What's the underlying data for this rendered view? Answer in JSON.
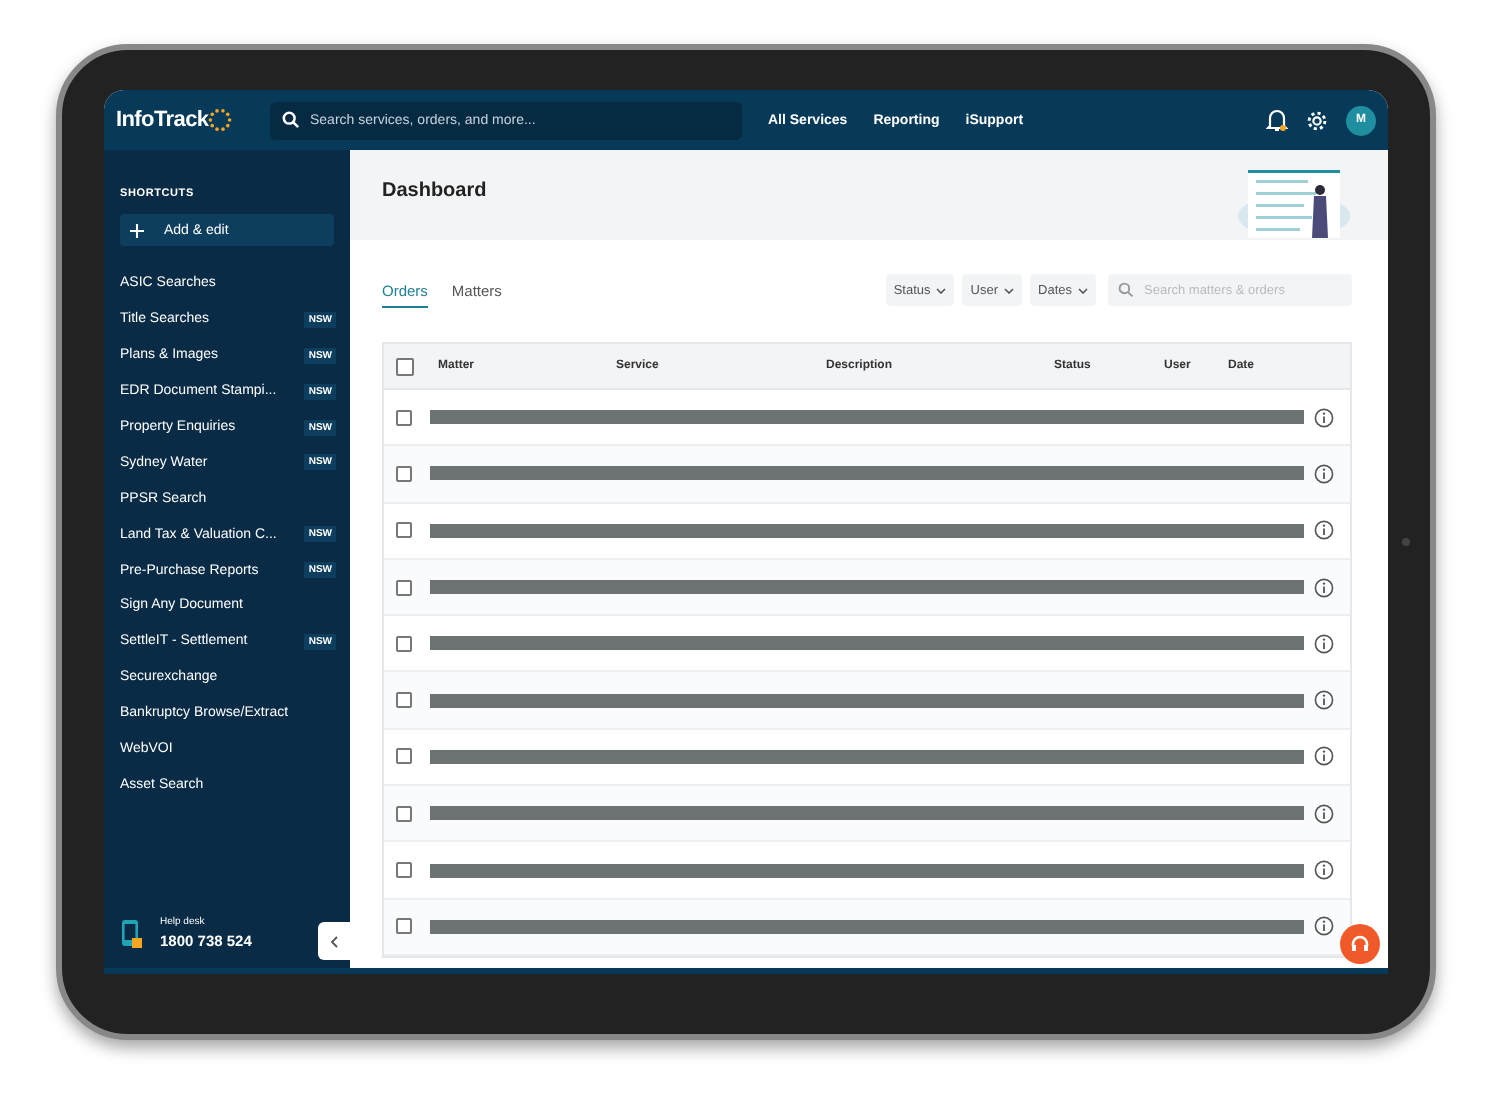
{
  "topbar": {
    "logo": "InfoTrack",
    "search": {
      "placeholder": "Search services, orders, and more..."
    },
    "nav": [
      "All Services",
      "Reporting",
      "iSupport"
    ],
    "notifications": true,
    "avatar": "M"
  },
  "sidebar": {
    "heading": "SHORTCUTS",
    "add_button": "Add & edit",
    "items": [
      {
        "label": "ASIC Searches"
      },
      {
        "label": "Title Searches",
        "badge": "NSW"
      },
      {
        "label": "Plans & Images",
        "badge": "NSW"
      },
      {
        "label": "EDR Document Stampi...",
        "badge": "NSW"
      },
      {
        "label": "Property Enquiries",
        "badge": "NSW"
      },
      {
        "label": "Sydney Water",
        "badge": "NSW"
      },
      {
        "label": "PPSR Search"
      },
      {
        "label": "Land Tax & Valuation C...",
        "badge": "NSW"
      },
      {
        "label": "Pre-Purchase Reports",
        "badge": "NSW"
      },
      {
        "label": "Sign Any Document"
      },
      {
        "label": "SettleIT - Settlement",
        "badge": "NSW"
      },
      {
        "label": "Securexchange"
      },
      {
        "label": "Bankruptcy Browse/Extract"
      },
      {
        "label": "WebVOI"
      },
      {
        "label": "Asset Search"
      }
    ],
    "help": {
      "label": "Help desk",
      "phone": "1800 738 524"
    }
  },
  "page": {
    "title": "Dashboard",
    "tabs": [
      {
        "label": "Orders",
        "selected": true
      },
      {
        "label": "Matters",
        "selected": false
      }
    ],
    "filters": [
      "Status",
      "User",
      "Dates"
    ],
    "search": {
      "placeholder": "Search matters & orders"
    },
    "table": {
      "columns": [
        "Matter",
        "Service",
        "Description",
        "Status",
        "User",
        "Date"
      ],
      "select_all": {
        "checked": false
      },
      "rows": [
        {
          "checked": false
        },
        {
          "checked": false
        },
        {
          "checked": false
        },
        {
          "checked": false
        },
        {
          "checked": false
        },
        {
          "checked": false
        },
        {
          "checked": false
        },
        {
          "checked": false
        },
        {
          "checked": false
        },
        {
          "checked": false
        }
      ]
    }
  }
}
